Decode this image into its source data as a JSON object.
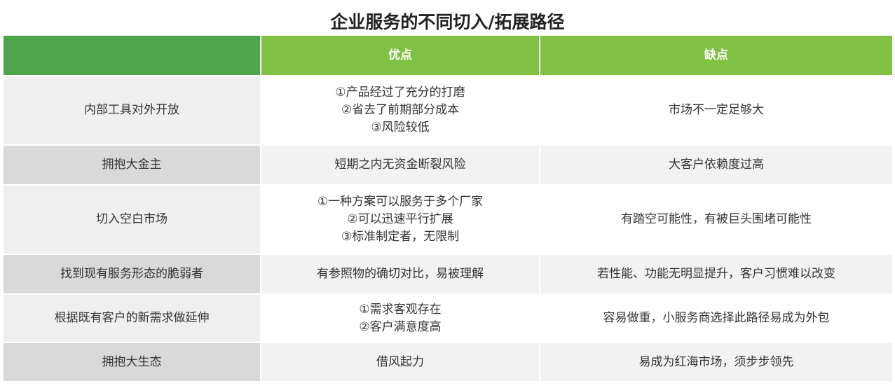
{
  "title": "企业服务的不同切入/拓展路径",
  "columns": {
    "corner": "",
    "pros": "优点",
    "cons": "缺点"
  },
  "rows": [
    {
      "path": "内部工具对外开放",
      "pros": [
        "①产品经过了充分的打磨",
        "②省去了前期部分成本",
        "③风险较低"
      ],
      "cons": [
        "市场不一定足够大"
      ]
    },
    {
      "path": "拥抱大金主",
      "pros": [
        "短期之内无资金断裂风险"
      ],
      "cons": [
        "大客户依赖度过高"
      ]
    },
    {
      "path": "切入空白市场",
      "pros": [
        "①一种方案可以服务于多个厂家",
        "②可以迅速平行扩展",
        "③标准制定者，无限制"
      ],
      "cons": [
        "有踏空可能性，有被巨头围堵可能性"
      ]
    },
    {
      "path": "找到现有服务形态的脆弱者",
      "pros": [
        "有参照物的确切对比，易被理解"
      ],
      "cons": [
        "若性能、功能无明显提升，客户习惯难以改变"
      ]
    },
    {
      "path": "根据既有客户的新需求做延伸",
      "pros": [
        "①需求客观存在",
        "②客户满意度高"
      ],
      "cons": [
        "容易做重，小服务商选择此路径易成为外包"
      ]
    },
    {
      "path": "拥抱大生态",
      "pros": [
        "借风起力"
      ],
      "cons": [
        "易成为红海市场，须步步领先"
      ]
    }
  ],
  "colors": {
    "header_corner": "#4ea54b",
    "header_green": "#7fc243",
    "row_label_light": "#efefef",
    "row_label_dark": "#d9d9d9",
    "cell_alt": "#f2f2f2"
  }
}
